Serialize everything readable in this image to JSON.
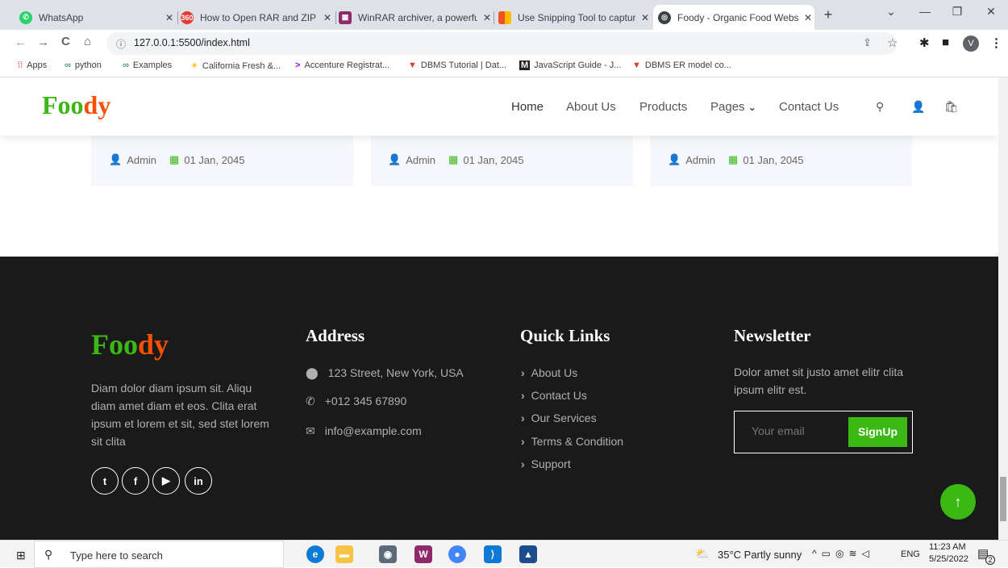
{
  "browser": {
    "tabs": [
      {
        "title": "WhatsApp",
        "icon": "whatsapp-icon"
      },
      {
        "title": "How to Open RAR and ZIP Fi",
        "icon": "360-icon"
      },
      {
        "title": "WinRAR archiver, a powerful",
        "icon": "winrar-icon"
      },
      {
        "title": "Use Snipping Tool to capture",
        "icon": "microsoft-icon"
      },
      {
        "title": "Foody - Organic Food Webs",
        "icon": "globe-icon",
        "active": true
      }
    ],
    "url": "127.0.0.1:5500/index.html",
    "profile_initial": "V",
    "bookmarks": [
      {
        "label": "Apps",
        "icon": "apps-grid-icon"
      },
      {
        "label": "python",
        "icon": "link-icon"
      },
      {
        "label": "Examples",
        "icon": "link-icon"
      },
      {
        "label": "California Fresh &...",
        "icon": "sun-icon"
      },
      {
        "label": "Accenture Registrat...",
        "icon": "accenture-icon"
      },
      {
        "label": "DBMS Tutorial | Dat...",
        "icon": "tutorial-icon"
      },
      {
        "label": "JavaScript Guide - J...",
        "icon": "m-icon"
      },
      {
        "label": "DBMS ER model co...",
        "icon": "tutorial-icon"
      }
    ]
  },
  "site": {
    "logo_part1": "Foo",
    "logo_part2": "dy",
    "nav": [
      "Home",
      "About Us",
      "Products",
      "Pages",
      "Contact Us"
    ],
    "pages_caret": "⌄",
    "colors": {
      "brand_green": "#3cb815",
      "brand_orange": "#f65005",
      "footer_bg": "#1a1a1a"
    }
  },
  "blog_cards": [
    {
      "author": "Admin",
      "date": "01 Jan, 2045"
    },
    {
      "author": "Admin",
      "date": "01 Jan, 2045"
    },
    {
      "author": "Admin",
      "date": "01 Jan, 2045"
    }
  ],
  "footer": {
    "about_text": "Diam dolor diam ipsum sit. Aliqu diam amet diam et eos. Clita erat ipsum et lorem et sit, sed stet lorem sit clita",
    "address_title": "Address",
    "address": "123 Street, New York, USA",
    "phone": "+012 345 67890",
    "email": "info@example.com",
    "quick_links_title": "Quick Links",
    "quick_links": [
      "About Us",
      "Contact Us",
      "Our Services",
      "Terms & Condition",
      "Support"
    ],
    "newsletter_title": "Newsletter",
    "newsletter_text": "Dolor amet sit justo amet elitr clita ipsum elitr est.",
    "email_placeholder": "Your email",
    "signup_label": "SignUp",
    "social": [
      "twitter-icon",
      "facebook-icon",
      "youtube-icon",
      "linkedin-icon"
    ]
  },
  "taskbar": {
    "search_placeholder": "Type here to search",
    "weather": "35°C  Partly sunny",
    "lang": "ENG",
    "time": "11:23 AM",
    "date": "5/25/2022",
    "notif_count": "2"
  }
}
